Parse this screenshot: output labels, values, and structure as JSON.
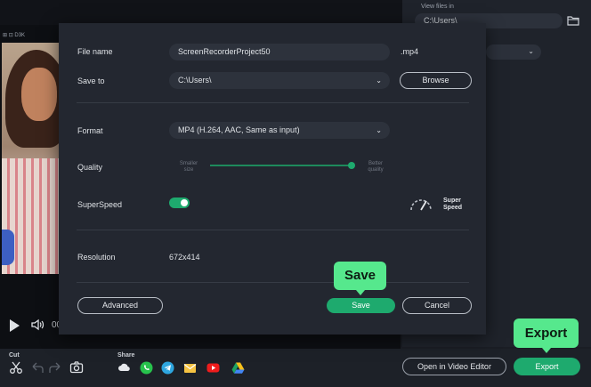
{
  "background": {
    "video_toolbar_text": "⊞ ⊡ D3K",
    "time_fragment": "00",
    "right_panel": {
      "view_files_label": "View files in",
      "view_files_path": "C:\\Users\\"
    },
    "bottom_bar": {
      "cut_label": "Cut",
      "share_label": "Share",
      "open_editor_label": "Open in Video Editor",
      "export_label": "Export"
    }
  },
  "dialog": {
    "file_name_label": "File name",
    "file_name_value": "ScreenRecorderProject50",
    "file_extension": ".mp4",
    "save_to_label": "Save to",
    "save_to_value": "C:\\Users\\",
    "browse_label": "Browse",
    "format_label": "Format",
    "format_value": "MP4 (H.264, AAC, Same as input)",
    "quality_label": "Quality",
    "quality_left_line1": "Smaller",
    "quality_left_line2": "size",
    "quality_right_line1": "Better",
    "quality_right_line2": "quality",
    "quality_level": 0.98,
    "superspeed_label": "SuperSpeed",
    "superspeed_on": true,
    "superspeed_badge_line1": "Super",
    "superspeed_badge_line2": "Speed",
    "resolution_label": "Resolution",
    "resolution_value": "672x414",
    "advanced_label": "Advanced",
    "save_label": "Save",
    "cancel_label": "Cancel"
  },
  "callouts": {
    "save": "Save",
    "export": "Export"
  },
  "colors": {
    "accent_green": "#1eaa6e",
    "callout_green": "#56e88d",
    "dialog_bg": "#232730",
    "field_bg": "#2d323c"
  },
  "icons": {
    "play": "play-icon",
    "volume": "volume-icon",
    "folder": "folder-icon",
    "cut": "scissors-icon",
    "undo": "undo-icon",
    "redo": "redo-icon",
    "snapshot": "camera-icon",
    "share": [
      "cloud-icon",
      "whatsapp-icon",
      "telegram-icon",
      "mail-icon",
      "youtube-icon",
      "google-drive-icon"
    ],
    "superspeed": "speedometer-icon"
  }
}
